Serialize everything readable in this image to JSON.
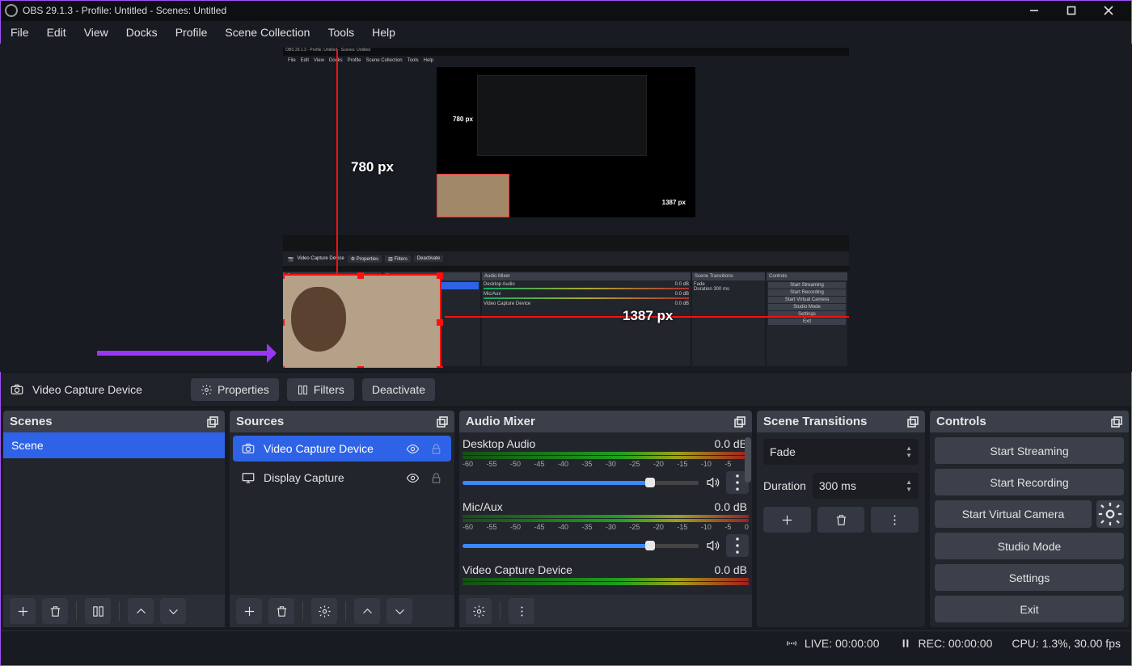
{
  "titlebar": {
    "title": "OBS 29.1.3 - Profile: Untitled - Scenes: Untitled"
  },
  "menubar": [
    "File",
    "Edit",
    "View",
    "Docks",
    "Profile",
    "Scene Collection",
    "Tools",
    "Help"
  ],
  "preview": {
    "px_v": "780 px",
    "px_h": "1387 px"
  },
  "source_context": {
    "name": "Video Capture Device",
    "properties": "Properties",
    "filters": "Filters",
    "deactivate": "Deactivate"
  },
  "docks": {
    "scenes": {
      "title": "Scenes",
      "items": [
        "Scene"
      ]
    },
    "sources": {
      "title": "Sources",
      "items": [
        {
          "label": "Video Capture Device",
          "icon": "camera",
          "selected": true,
          "visible": true,
          "locked": false
        },
        {
          "label": "Display Capture",
          "icon": "display",
          "selected": false,
          "visible": true,
          "locked": true
        }
      ]
    },
    "mixer": {
      "title": "Audio Mixer",
      "ticks": [
        "-60",
        "-55",
        "-50",
        "-45",
        "-40",
        "-35",
        "-30",
        "-25",
        "-20",
        "-15",
        "-10",
        "-5",
        "0"
      ],
      "channels": [
        {
          "name": "Desktop Audio",
          "db": "0.0 dB"
        },
        {
          "name": "Mic/Aux",
          "db": "0.0 dB"
        },
        {
          "name": "Video Capture Device",
          "db": "0.0 dB"
        }
      ]
    },
    "transitions": {
      "title": "Scene Transitions",
      "current": "Fade",
      "duration_label": "Duration",
      "duration": "300 ms"
    },
    "controls": {
      "title": "Controls",
      "start_streaming": "Start Streaming",
      "start_recording": "Start Recording",
      "start_virtual_camera": "Start Virtual Camera",
      "studio_mode": "Studio Mode",
      "settings": "Settings",
      "exit": "Exit"
    }
  },
  "statusbar": {
    "live": "LIVE: 00:00:00",
    "rec": "REC: 00:00:00",
    "cpu": "CPU: 1.3%, 30.00 fps"
  }
}
